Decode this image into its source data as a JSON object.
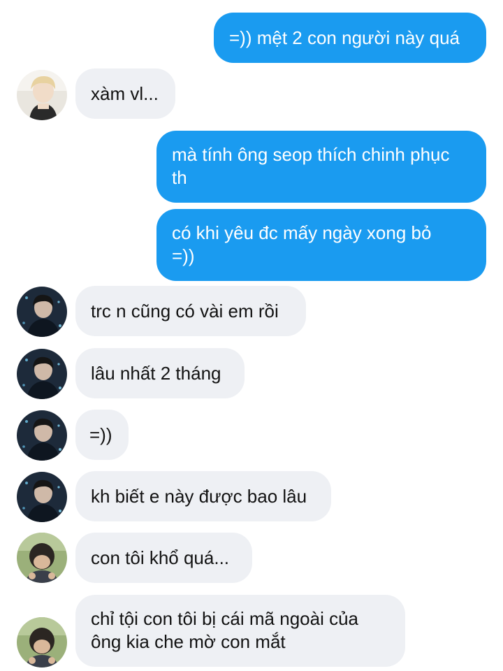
{
  "colors": {
    "outgoing_bubble": "#1a9bf0",
    "incoming_bubble": "#eef0f4",
    "outgoing_text": "#ffffff",
    "incoming_text": "#121212"
  },
  "messages": [
    {
      "sender": "me",
      "text": "=)) mệt 2 con người này quá"
    },
    {
      "sender": "blond-avatar",
      "text": "xàm vl..."
    },
    {
      "sender": "me",
      "text": "mà tính ông seop thích chinh phục\nth"
    },
    {
      "sender": "me",
      "text": "có khi yêu đc mấy ngày xong bỏ\n=))"
    },
    {
      "sender": "dark-avatar",
      "text": "trc n cũng có vài em rồi"
    },
    {
      "sender": "dark-avatar",
      "text": "lâu nhất 2 tháng"
    },
    {
      "sender": "dark-avatar",
      "text": "=))"
    },
    {
      "sender": "dark-avatar",
      "text": "kh biết e này được bao lâu"
    },
    {
      "sender": "child-avatar",
      "text": "con tôi khổ quá..."
    },
    {
      "sender": "child-avatar",
      "text": "chỉ tội con tôi bị cái mã ngoài của\nông kia che mờ con mắt"
    }
  ]
}
